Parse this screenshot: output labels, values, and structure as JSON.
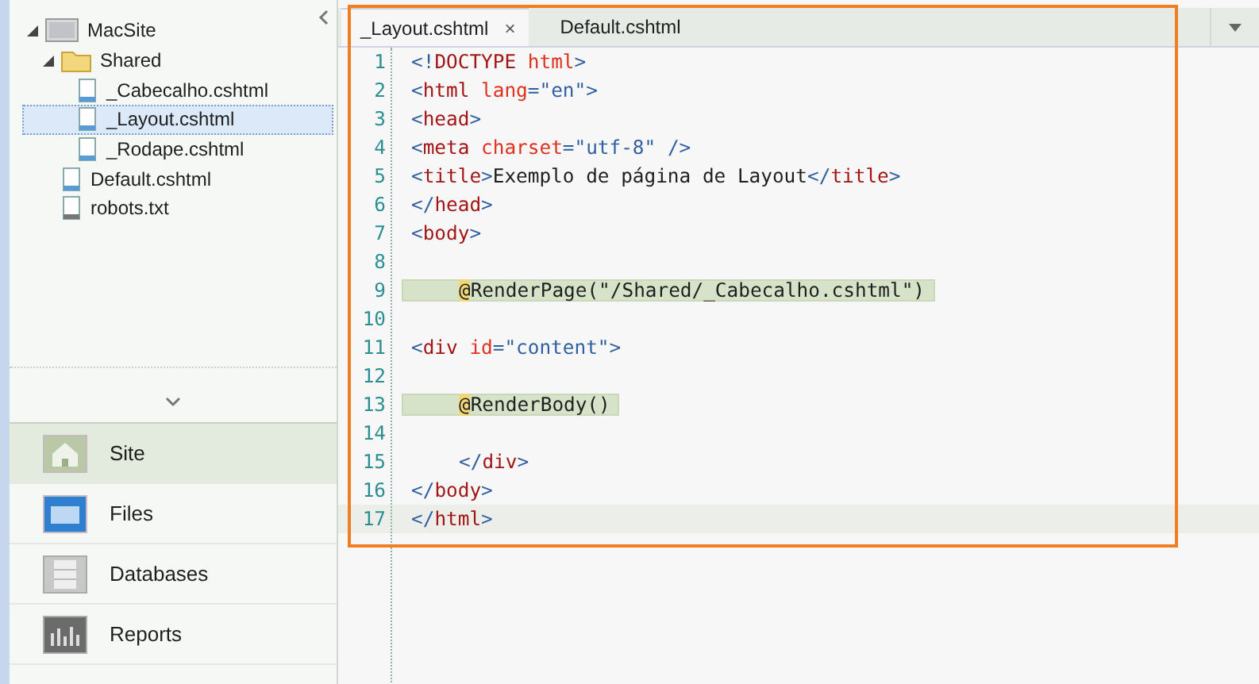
{
  "tree": [
    {
      "label": "MacSite",
      "kind": "site",
      "expanded": true,
      "selected": false,
      "children": [
        {
          "label": "Shared",
          "kind": "folder",
          "expanded": true,
          "selected": false,
          "children": [
            {
              "label": "_Cabecalho.cshtml",
              "kind": "file",
              "selected": false
            },
            {
              "label": "_Layout.cshtml",
              "kind": "file",
              "selected": true
            },
            {
              "label": "_Rodape.cshtml",
              "kind": "file",
              "selected": false
            }
          ]
        },
        {
          "label": "Default.cshtml",
          "kind": "file",
          "selected": false
        },
        {
          "label": "robots.txt",
          "kind": "text",
          "selected": false
        }
      ]
    }
  ],
  "nav": [
    {
      "label": "Site",
      "kind": "site",
      "selected": true
    },
    {
      "label": "Files",
      "kind": "files",
      "selected": false
    },
    {
      "label": "Databases",
      "kind": "databases",
      "selected": false
    },
    {
      "label": "Reports",
      "kind": "reports",
      "selected": false
    }
  ],
  "tabs": [
    {
      "label": "_Layout.cshtml",
      "selected": true,
      "close": "×"
    },
    {
      "label": "Default.cshtml",
      "selected": false
    }
  ],
  "editor": {
    "lines": [
      {
        "number": "1",
        "current": false,
        "indented": false,
        "segments": [
          {
            "kind": "delim",
            "text": "<!"
          },
          {
            "kind": "tag",
            "text": "DOCTYPE"
          },
          {
            "kind": "attr",
            "text": " html"
          },
          {
            "kind": "delim",
            "text": ">"
          }
        ]
      },
      {
        "number": "2",
        "current": false,
        "indented": false,
        "segments": [
          {
            "kind": "delim",
            "text": "<"
          },
          {
            "kind": "tag",
            "text": "html"
          },
          {
            "kind": "attr",
            "text": " lang"
          },
          {
            "kind": "delim",
            "text": "=\"en\">"
          }
        ]
      },
      {
        "number": "3",
        "current": false,
        "indented": false,
        "segments": [
          {
            "kind": "delim",
            "text": "<"
          },
          {
            "kind": "tag",
            "text": "head"
          },
          {
            "kind": "delim",
            "text": ">"
          }
        ]
      },
      {
        "number": "4",
        "current": false,
        "indented": false,
        "segments": [
          {
            "kind": "delim",
            "text": "<"
          },
          {
            "kind": "tag",
            "text": "meta"
          },
          {
            "kind": "attr",
            "text": " charset"
          },
          {
            "kind": "delim",
            "text": "=\"utf-8\" />"
          }
        ]
      },
      {
        "number": "5",
        "current": false,
        "indented": false,
        "segments": [
          {
            "kind": "delim",
            "text": "<"
          },
          {
            "kind": "tag",
            "text": "title"
          },
          {
            "kind": "delim",
            "text": ">"
          },
          {
            "kind": "plain",
            "text": "Exemplo de página de Layout"
          },
          {
            "kind": "delim",
            "text": "</"
          },
          {
            "kind": "tag",
            "text": "title"
          },
          {
            "kind": "delim",
            "text": ">"
          }
        ]
      },
      {
        "number": "6",
        "current": false,
        "indented": false,
        "segments": [
          {
            "kind": "delim",
            "text": "</"
          },
          {
            "kind": "tag",
            "text": "head"
          },
          {
            "kind": "delim",
            "text": ">"
          }
        ]
      },
      {
        "number": "7",
        "current": false,
        "indented": false,
        "segments": [
          {
            "kind": "delim",
            "text": "<"
          },
          {
            "kind": "tag",
            "text": "body"
          },
          {
            "kind": "delim",
            "text": ">"
          }
        ]
      },
      {
        "number": "8",
        "current": false
      },
      {
        "number": "9",
        "highlight": true,
        "current": false,
        "indented": true,
        "segments": [
          {
            "kind": "razor-at",
            "text": "@"
          },
          {
            "kind": "plain",
            "text": "RenderPage(\"/Shared/_Cabecalho.cshtml\")"
          }
        ]
      },
      {
        "number": "10",
        "current": false
      },
      {
        "number": "11",
        "current": false,
        "indented": false,
        "segments": [
          {
            "kind": "delim",
            "text": "<"
          },
          {
            "kind": "tag",
            "text": "div"
          },
          {
            "kind": "attr",
            "text": " id"
          },
          {
            "kind": "delim",
            "text": "=\"content\">"
          }
        ]
      },
      {
        "number": "12",
        "current": false
      },
      {
        "number": "13",
        "highlight": true,
        "current": false,
        "indented": true,
        "segments": [
          {
            "kind": "razor-at",
            "text": "@"
          },
          {
            "kind": "plain",
            "text": "RenderBody()"
          }
        ]
      },
      {
        "number": "14",
        "current": false
      },
      {
        "number": "15",
        "current": false,
        "indented": true,
        "segments": [
          {
            "kind": "delim",
            "text": "</"
          },
          {
            "kind": "tag",
            "text": "div"
          },
          {
            "kind": "delim",
            "text": ">"
          }
        ]
      },
      {
        "number": "16",
        "current": false,
        "indented": false,
        "segments": [
          {
            "kind": "delim",
            "text": "</"
          },
          {
            "kind": "tag",
            "text": "body"
          },
          {
            "kind": "delim",
            "text": ">"
          }
        ]
      },
      {
        "number": "17",
        "current": true,
        "indented": false,
        "segments": [
          {
            "kind": "delim",
            "text": "</"
          },
          {
            "kind": "tag",
            "text": "html"
          },
          {
            "kind": "delim",
            "text": ">"
          }
        ]
      }
    ]
  }
}
